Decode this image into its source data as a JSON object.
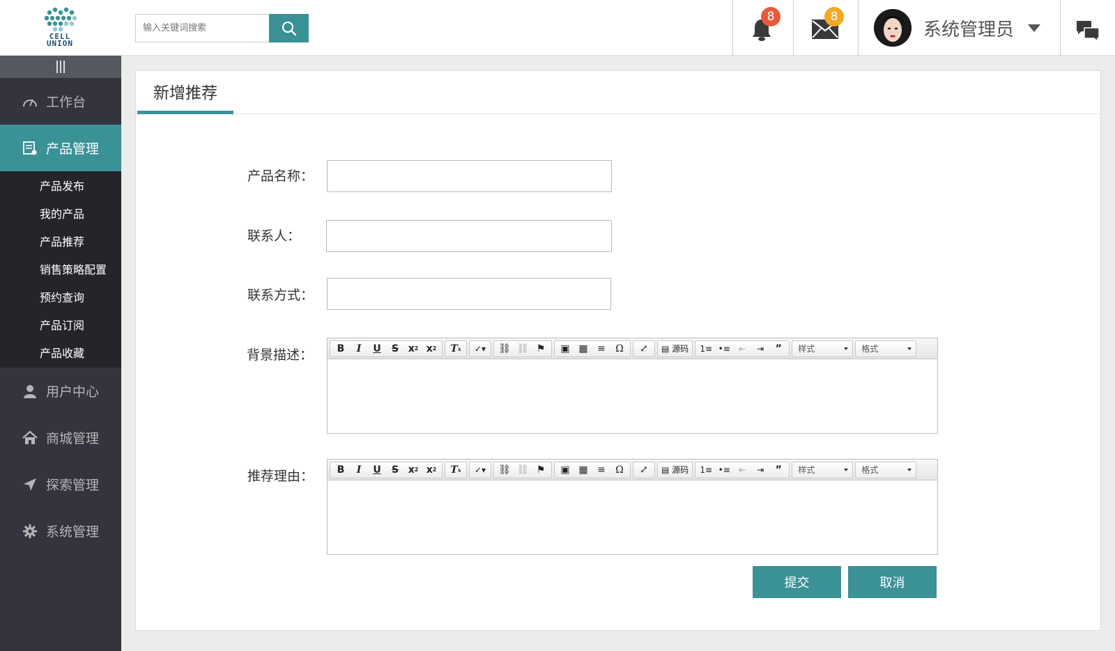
{
  "header": {
    "logo_line1": "CELL",
    "logo_line2": "UNION",
    "search_placeholder": "输入关键词搜索",
    "notifications_count": "8",
    "messages_count": "8",
    "username": "系统管理员"
  },
  "sidebar": {
    "items": [
      {
        "label": "工作台"
      },
      {
        "label": "产品管理"
      },
      {
        "label": "用户中心"
      },
      {
        "label": "商城管理"
      },
      {
        "label": "探索管理"
      },
      {
        "label": "系统管理"
      }
    ],
    "sub_items": [
      {
        "label": "产品发布"
      },
      {
        "label": "我的产品"
      },
      {
        "label": "产品推荐"
      },
      {
        "label": "销售策略配置"
      },
      {
        "label": "预约查询"
      },
      {
        "label": "产品订阅"
      },
      {
        "label": "产品收藏"
      }
    ]
  },
  "page": {
    "tab_title": "新增推荐"
  },
  "form": {
    "product_name_label": "产品名称：",
    "contact_label": "联系人：",
    "contact_method_label": "联系方式：",
    "background_label": "背景描述：",
    "reason_label": "推荐理由：",
    "product_name_value": "",
    "contact_value": "",
    "contact_method_value": ""
  },
  "editor": {
    "source_label": "源码",
    "style_select": "样式",
    "format_select": "格式"
  },
  "buttons": {
    "submit": "提交",
    "cancel": "取消"
  },
  "colors": {
    "accent": "#3a9196",
    "sidebar_bg": "#33343d",
    "badge_red": "#e85a3a",
    "badge_orange": "#f5a623"
  }
}
